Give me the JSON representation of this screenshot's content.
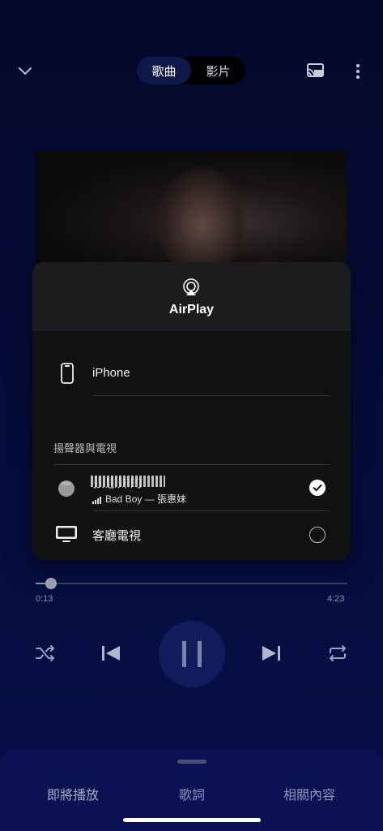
{
  "header": {
    "tabs": [
      {
        "label": "歌曲",
        "active": true
      },
      {
        "label": "影片",
        "active": false
      }
    ],
    "icons": [
      "chevron-down-icon",
      "cast-icon",
      "more-vertical-icon"
    ]
  },
  "airplay": {
    "title": "AirPlay",
    "icon": "airplay-icon",
    "this_device": "iPhone",
    "section_label": "揚聲器與電視",
    "speaker": {
      "name": "張惠妹的",
      "now_playing": "Bad Boy — 張惠妹",
      "selected": true
    },
    "tv": {
      "name": "客廳電視",
      "selected": false
    }
  },
  "player": {
    "current_time": "0:13",
    "total_time": "4:23",
    "progress_fraction": 0.049
  },
  "bottom_tabs": [
    "即將播放",
    "歌詞",
    "相關內容"
  ],
  "colors": {
    "background": "#050b36",
    "play_button": "#111c5a",
    "bottom_sheet": "#0a1254"
  }
}
